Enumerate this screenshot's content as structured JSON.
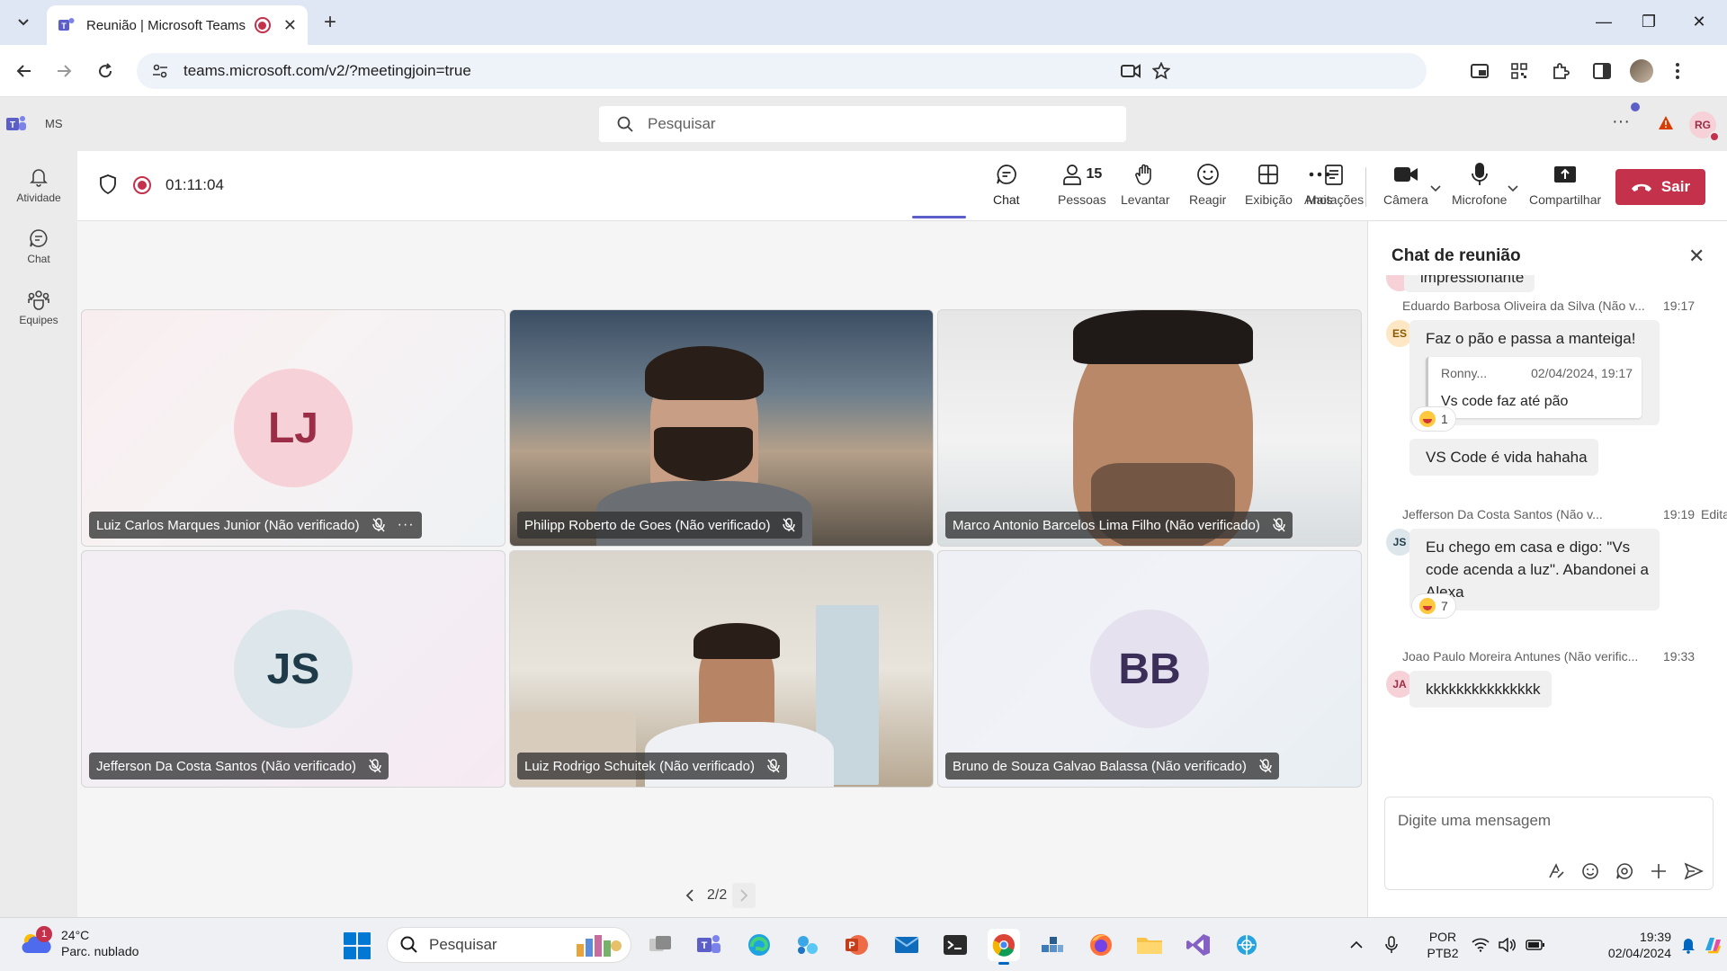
{
  "browser": {
    "tab_title": "Reunião | Microsoft Teams",
    "url": "teams.microsoft.com/v2/?meetingjoin=true"
  },
  "teams": {
    "tenant": "MS",
    "search_placeholder": "Pesquisar",
    "me_initials": "RG",
    "rail": [
      {
        "label": "Atividade",
        "icon": "bell-icon"
      },
      {
        "label": "Chat",
        "icon": "chat-icon"
      },
      {
        "label": "Equipes",
        "icon": "teams-icon"
      }
    ]
  },
  "meeting": {
    "timer": "01:11:04",
    "controls": {
      "chat": "Chat",
      "people": "Pessoas",
      "people_count": "15",
      "raise": "Levantar",
      "react": "Reagir",
      "view": "Exibição",
      "notes": "Anotações",
      "more": "Mais",
      "camera": "Câmera",
      "mic": "Microfone",
      "share": "Compartilhar",
      "leave": "Sair"
    },
    "participants": [
      {
        "name": "Luiz Carlos Marques Junior (Não verificado)",
        "initials": "LJ",
        "video": false
      },
      {
        "name": "Philipp Roberto de Goes (Não verificado)",
        "initials": "",
        "video": true
      },
      {
        "name": "Marco Antonio Barcelos Lima Filho (Não verificado)",
        "initials": "",
        "video": true
      },
      {
        "name": "Jefferson Da Costa Santos (Não verificado)",
        "initials": "JS",
        "video": false
      },
      {
        "name": "Luiz Rodrigo Schuitek (Não verificado)",
        "initials": "",
        "video": true
      },
      {
        "name": "Bruno de Souza Galvao Balassa (Não verificado)",
        "initials": "BB",
        "video": false
      }
    ],
    "pager": "2/2"
  },
  "chat": {
    "title": "Chat de reunião",
    "partial_message": "impressionante",
    "messages": [
      {
        "author": "Eduardo Barbosa Oliveira da Silva (Não v...",
        "initials": "ES",
        "time": "19:17",
        "text": "Faz o pão e passa a manteiga!",
        "quote_author": "Ronny...",
        "quote_time": "02/04/2024, 19:17",
        "quote_text": "Vs code faz até pão",
        "reaction_count": "1",
        "followup": "VS Code é vida hahaha"
      },
      {
        "author": "Jefferson Da Costa Santos (Não v...",
        "initials": "JS",
        "time": "19:19",
        "edited": "Editad",
        "text": "Eu chego em casa e digo: \"Vs code acenda a luz\". Abandonei a Alexa",
        "reaction_count": "7"
      },
      {
        "author": "Joao Paulo Moreira Antunes (Não verific...",
        "initials": "JA",
        "time": "19:33",
        "text": "kkkkkkkkkkkkkkk"
      }
    ],
    "compose_placeholder": "Digite uma mensagem"
  },
  "taskbar": {
    "temperature": "24°C",
    "weather": "Parc. nublado",
    "weather_badge": "1",
    "search_placeholder": "Pesquisar",
    "lang_top": "POR",
    "lang_bottom": "PTB2",
    "time": "19:39",
    "date": "02/04/2024"
  }
}
